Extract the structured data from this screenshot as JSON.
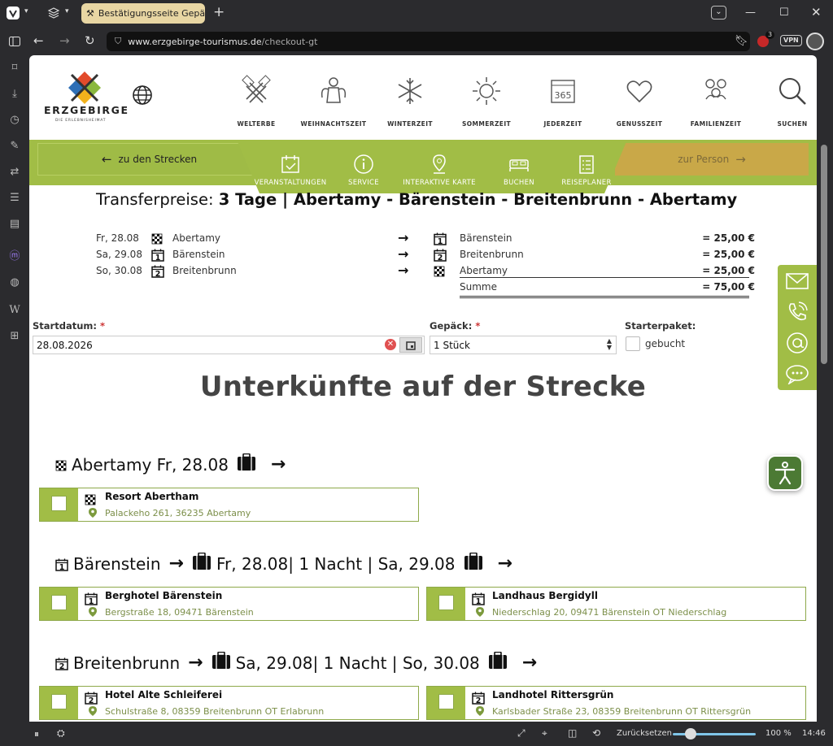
{
  "browser": {
    "tab_title": "Bestätigungsseite Gepäcktr",
    "url_host": "www.erzgebirge-tourismus.de",
    "url_path": "/checkout-gt",
    "vpn_label": "VPN",
    "badge_count": "3",
    "reset_label": "Zurücksetzen",
    "zoom": "100 %",
    "clock": "14:46"
  },
  "header": {
    "logo_text": "ERZGEBIRGE",
    "logo_sub": "DIE ERLEBNISHEIMAT",
    "nav": [
      {
        "label": "WELTERBE",
        "icon": "hammers-icon"
      },
      {
        "label": "WEIHNACHTSZEIT",
        "icon": "angel-icon"
      },
      {
        "label": "WINTERZEIT",
        "icon": "snowflake-icon"
      },
      {
        "label": "SOMMERZEIT",
        "icon": "sun-icon"
      },
      {
        "label": "JEDERZEIT",
        "icon": "calendar-365-icon"
      },
      {
        "label": "GENUSSZEIT",
        "icon": "heart-icon"
      },
      {
        "label": "FAMILIENZEIT",
        "icon": "family-icon"
      },
      {
        "label": "SUCHEN",
        "icon": "search-icon"
      }
    ]
  },
  "subnav": {
    "back_label": "zu den Strecken",
    "forward_label": "zur Person",
    "items": [
      {
        "label": "VERANSTALTUNGEN",
        "icon": "calendar-check-icon"
      },
      {
        "label": "SERVICE",
        "icon": "info-icon"
      },
      {
        "label": "INTERAKTIVE KARTE",
        "icon": "map-pin-icon"
      },
      {
        "label": "BUCHEN",
        "icon": "bed-icon"
      },
      {
        "label": "REISEPLANER",
        "icon": "checklist-icon"
      }
    ]
  },
  "transfer": {
    "title_prefix": "Transferpreise:",
    "title_route": "3 Tage | Abertamy - Bärenstein - Breitenbrunn - Abertamy",
    "rows": [
      {
        "day": "Fr, 28.08",
        "from_icon": "flag",
        "from": "Abertamy",
        "to_icon": "1",
        "to": "Bärenstein",
        "price": "= 25,00 €"
      },
      {
        "day": "Sa, 29.08",
        "from_icon": "1",
        "from": "Bärenstein",
        "to_icon": "2",
        "to": "Breitenbrunn",
        "price": "= 25,00 €"
      },
      {
        "day": "So, 30.08",
        "from_icon": "2",
        "from": "Breitenbrunn",
        "to_icon": "flag",
        "to": "Abertamy",
        "price": "= 25,00 €"
      }
    ],
    "sum_label": "Summe",
    "sum_value": "= 75,00 €",
    "arrow": "→"
  },
  "form": {
    "start_label": "Startdatum:",
    "start_value": "28.08.2026",
    "luggage_label": "Gepäck:",
    "luggage_value": "1 Stück",
    "starter_label": "Starterpaket:",
    "starter_option": "gebucht",
    "required_mark": "*"
  },
  "accommodations": {
    "heading": "Unterkünfte auf der Strecke",
    "sections": [
      {
        "icon": "flag",
        "title": "Abertamy Fr, 28.08",
        "tail": "",
        "cards": [
          {
            "icon": "flag",
            "name": "Resort Abertham",
            "address": "Palackeho 261, 36235 Abertamy"
          }
        ]
      },
      {
        "icon": "1",
        "title": "Bärenstein",
        "tail": "Fr, 28.08| 1 Nacht | Sa, 29.08",
        "cards": [
          {
            "icon": "1",
            "name": "Berghotel Bärenstein",
            "address": "Bergstraße 18, 09471 Bärenstein"
          },
          {
            "icon": "1",
            "name": "Landhaus Bergidyll",
            "address": "Niederschlag 20, 09471 Bärenstein OT Niederschlag"
          }
        ]
      },
      {
        "icon": "2",
        "title": "Breitenbrunn",
        "tail": "Sa, 29.08| 1 Nacht | So, 30.08",
        "cards": [
          {
            "icon": "2",
            "name": "Hotel Alte Schleiferei",
            "address": "Schulstraße 8, 08359 Breitenbrunn OT Erlabrunn"
          },
          {
            "icon": "2",
            "name": "Landhotel Rittersgrün",
            "address": "Karlsbader Straße 23, 08359 Breitenbrunn OT Rittersgrün"
          }
        ]
      }
    ]
  },
  "colors": {
    "green": "#a1bd46",
    "gold": "#c9a848",
    "a11y": "#4c7a34"
  }
}
